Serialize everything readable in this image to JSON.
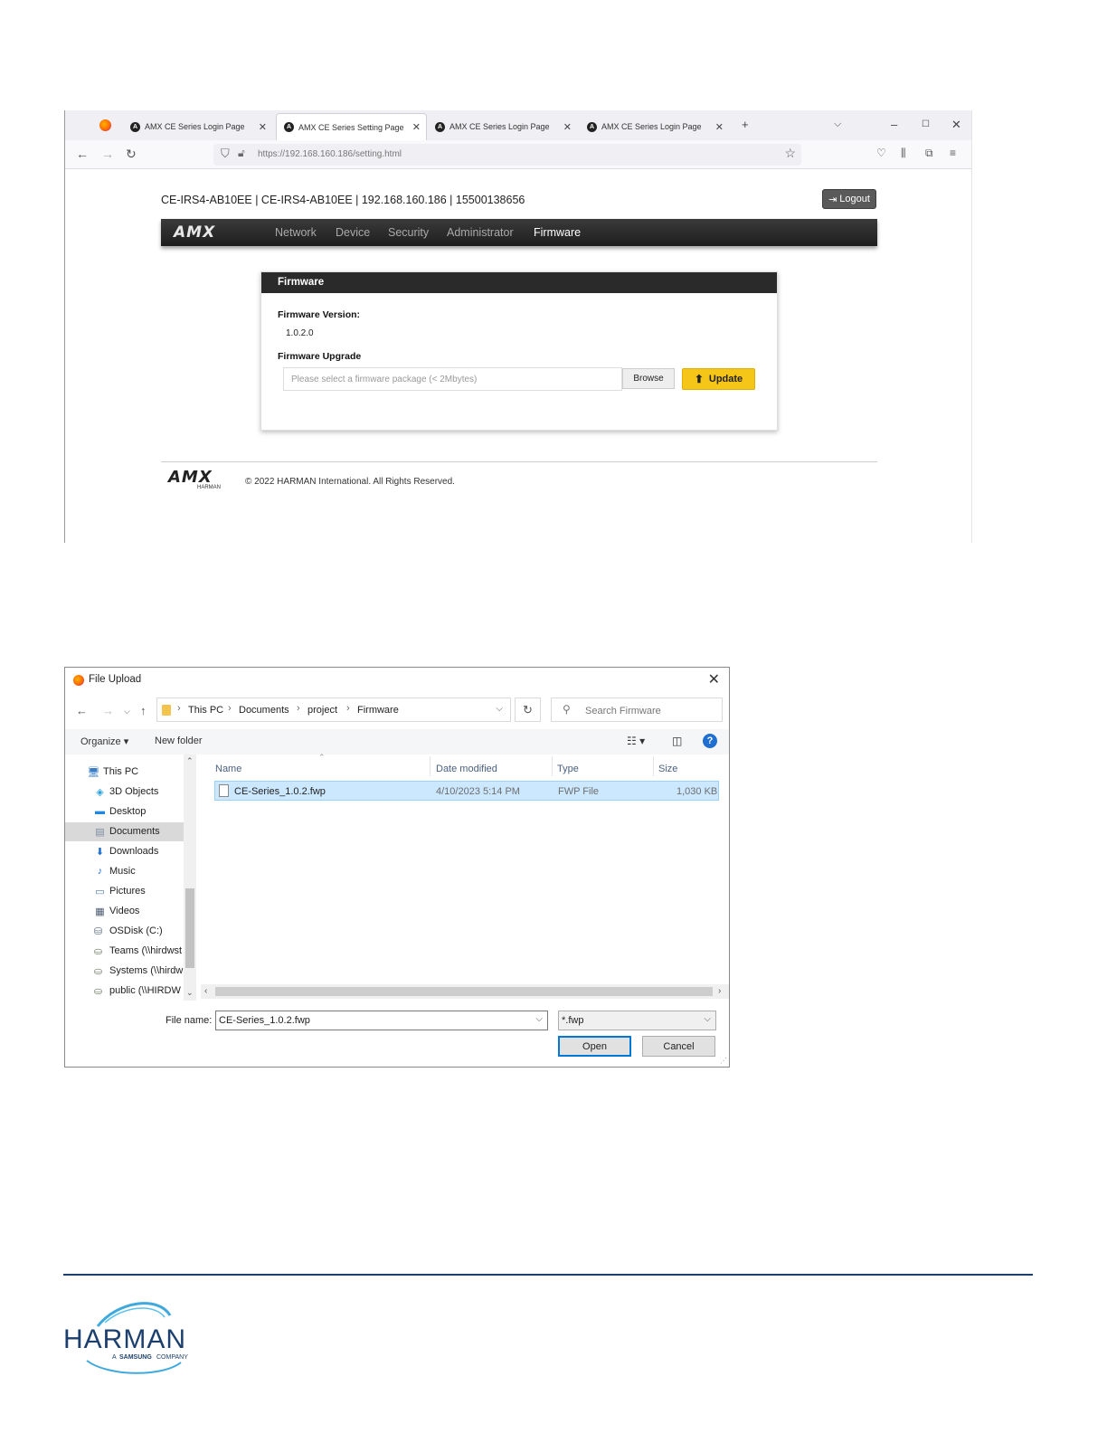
{
  "browser": {
    "tabs": [
      {
        "label": "AMX CE Series Login Page",
        "active": false
      },
      {
        "label": "AMX CE Series Setting Page",
        "active": true
      },
      {
        "label": "AMX CE Series Login Page",
        "active": false
      },
      {
        "label": "AMX CE Series Login Page",
        "active": false
      }
    ],
    "url": "https://192.168.160.186/setting.html"
  },
  "amx_page": {
    "header": "CE-IRS4-AB10EE  |  CE-IRS4-AB10EE  |  192.168.160.186  |  15500138656",
    "logout_label": "Logout",
    "logo": "AMX",
    "nav": [
      "Network",
      "Device",
      "Security",
      "Administrator",
      "Firmware"
    ],
    "nav_active": "Firmware",
    "panel": {
      "title": "Firmware",
      "version_label": "Firmware Version:",
      "version_value": "1.0.2.0",
      "upgrade_label": "Firmware Upgrade",
      "input_placeholder": "Please select a firmware package (< 2Mbytes)",
      "browse_label": "Browse",
      "update_label": "Update"
    },
    "footer_logo": "AMX",
    "footer_logo_sub": "HARMAN",
    "copyright": "© 2022 HARMAN International. All Rights Reserved."
  },
  "file_dialog": {
    "title": "File Upload",
    "breadcrumb": [
      "This PC",
      "Documents",
      "project",
      "Firmware"
    ],
    "search_placeholder": "Search Firmware",
    "organize_label": "Organize ▾",
    "new_folder_label": "New folder",
    "nav_items": [
      {
        "label": "This PC",
        "icon": "computer-icon"
      },
      {
        "label": "3D Objects",
        "icon": "cube-icon"
      },
      {
        "label": "Desktop",
        "icon": "desktop-icon"
      },
      {
        "label": "Documents",
        "icon": "documents-icon",
        "selected": true
      },
      {
        "label": "Downloads",
        "icon": "download-icon"
      },
      {
        "label": "Music",
        "icon": "music-icon"
      },
      {
        "label": "Pictures",
        "icon": "pictures-icon"
      },
      {
        "label": "Videos",
        "icon": "videos-icon"
      },
      {
        "label": "OSDisk (C:)",
        "icon": "disk-icon"
      },
      {
        "label": "Teams (\\\\hirdwst",
        "icon": "network-drive-icon"
      },
      {
        "label": "Systems (\\\\hirdw",
        "icon": "network-drive-icon"
      },
      {
        "label": "public (\\\\HIRDW",
        "icon": "network-drive-icon"
      }
    ],
    "columns": [
      "Name",
      "Date modified",
      "Type",
      "Size"
    ],
    "files": [
      {
        "name": "CE-Series_1.0.2.fwp",
        "date": "4/10/2023 5:14 PM",
        "type": "FWP File",
        "size": "1,030 KB"
      }
    ],
    "file_name_label": "File name:",
    "file_name_value": "CE-Series_1.0.2.fwp",
    "file_type_value": "*.fwp",
    "open_label": "Open",
    "cancel_label": "Cancel"
  },
  "doc_footer": {
    "brand": "HARMAN",
    "tagline_prefix": "A",
    "tagline_brand": "SAMSUNG",
    "tagline_suffix": "COMPANY"
  },
  "colors": {
    "amx_nav_bg": "#2a2a2a",
    "update_button": "#f5c518",
    "selection": "#cce8ff",
    "harman_blue": "#1c3f6e"
  }
}
